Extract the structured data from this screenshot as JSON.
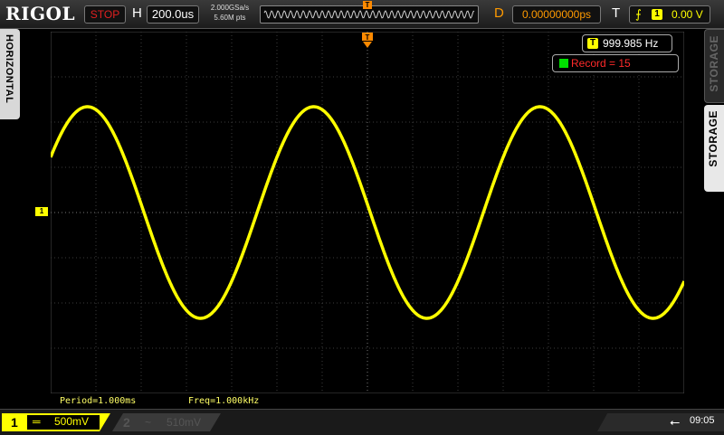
{
  "brand": "RIGOL",
  "status": {
    "run_state": "STOP",
    "run_color": "#e02020"
  },
  "horizontal": {
    "label": "H",
    "timebase": "200.0us",
    "sample_rate": "2.000GSa/s",
    "memory_depth": "5.60M pts"
  },
  "delay": {
    "label": "D",
    "value": "0.00000000ps"
  },
  "trigger": {
    "label": "T",
    "edge_icon": "rising-edge-icon",
    "source": "1",
    "level": "0.00 V",
    "marker": "T"
  },
  "side_tabs": {
    "left": "HORIZONTAL",
    "right_top": "STORAGE",
    "right_bottom": "STORAGE"
  },
  "measure": {
    "freq_icon": "T",
    "frequency": "999.985 Hz",
    "record": "Record = 15"
  },
  "channel_marker": "1",
  "bottom_meas": {
    "period": "Period=1.000ms",
    "freq": "Freq=1.000kHz"
  },
  "channels": [
    {
      "number": "1",
      "coupling": "═",
      "scale": "500mV",
      "active": true,
      "color": "#ffff00"
    },
    {
      "number": "2",
      "coupling": "~",
      "scale": "510mV",
      "active": false,
      "color": "#555555"
    }
  ],
  "clock": "09:05",
  "waveform": {
    "frequency_hz": 1000,
    "phase_deg_at_left": 180,
    "trace_color": "#ffff00"
  }
}
